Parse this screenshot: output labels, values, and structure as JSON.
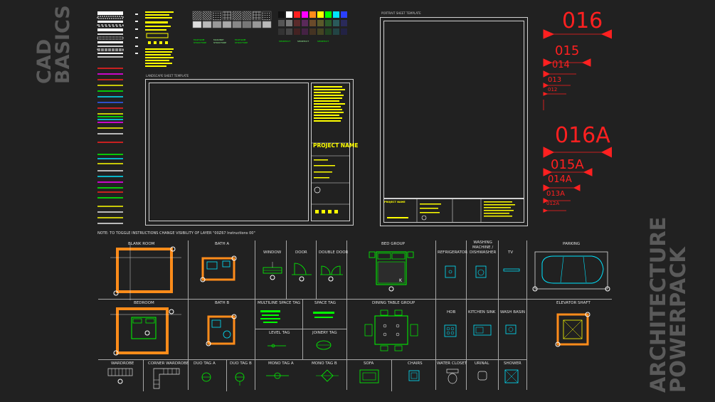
{
  "titles": {
    "cad_basics": "CAD\nBASICS",
    "architecture_powerpack": "ARCHITECTURE\nPOWERPACK"
  },
  "sheets": {
    "landscape_label": "LANDSCAPE SHEET TEMPLATE",
    "portrait_label": "PORTRAIT SHEET TEMPLATE",
    "project_name": "PROJECT NAME",
    "project_name_small": "PROJECT NAME"
  },
  "swatch_labels": {
    "hatch_left": "MULTILINE\nSTRUCTURE",
    "hatch_mid": "MASONRY\nSTRUCTURE",
    "hatch_right": "MULTILINE\nSTRUCTURE",
    "color_a": "SHORTCUT",
    "color_b": "SHORTCUT",
    "color_c": "SHORTCUT"
  },
  "level_markers": {
    "big1": "016",
    "l1": "015",
    "l2": "014",
    "l3": "013",
    "l4": "012",
    "big2": "016A",
    "m1": "015A",
    "m2": "014A",
    "m3": "013A",
    "m4": "012A"
  },
  "note": "NOTE: TO TOGGLE INSTRUCTIONS CHANGE VISIBILITY OF LAYER \"00Z67 Instructions 00\"",
  "blocks": {
    "blank_room": "BLANK ROOM",
    "bath_a": "BATH A",
    "window": "WINDOW",
    "door": "DOOR",
    "double_door": "DOUBLE DOOR",
    "bed_group": "BED GROUP",
    "refrigerator": "REFRIGERATOR",
    "washing_machine": "WASHING\nMACHINE /\nDISHWASHER",
    "tv": "TV",
    "parking": "PARKING",
    "bedroom": "BEDROOM",
    "bath_b": "BATH B",
    "multiline_space_tag": "MULTILINE SPACE TAG",
    "space_tag": "SPACE TAG",
    "dining_table_group": "DINING TABLE GROUP",
    "hob": "HOB",
    "kitchen_sink": "KITCHEN SINK",
    "wash_basin": "WASH BASIN",
    "elevator_shaft": "ELEVATOR SHAFT",
    "level_tag": "LEVEL TAG",
    "joinery_tag": "JOINERY TAG",
    "wardrobe": "WARDROBE",
    "corner_wardrobe": "CORNER WARDROBE",
    "duo_tag_a": "DUO TAG A",
    "duo_tag_b": "DUO TAG B",
    "mono_tag_a": "MONO TAG A",
    "mono_tag_b": "MONO TAG B",
    "sofa": "SOFA",
    "chairs": "CHAIRS",
    "water_closet": "WATER CLOSET",
    "urinal": "URINAL",
    "shower": "SHOWER"
  },
  "colors": {
    "background": "#212121",
    "red_markers": "#ff2020",
    "orange": "#ff8c1a",
    "yellow": "#ffff00",
    "green": "#00ff00",
    "cyan": "#00e5ff"
  }
}
